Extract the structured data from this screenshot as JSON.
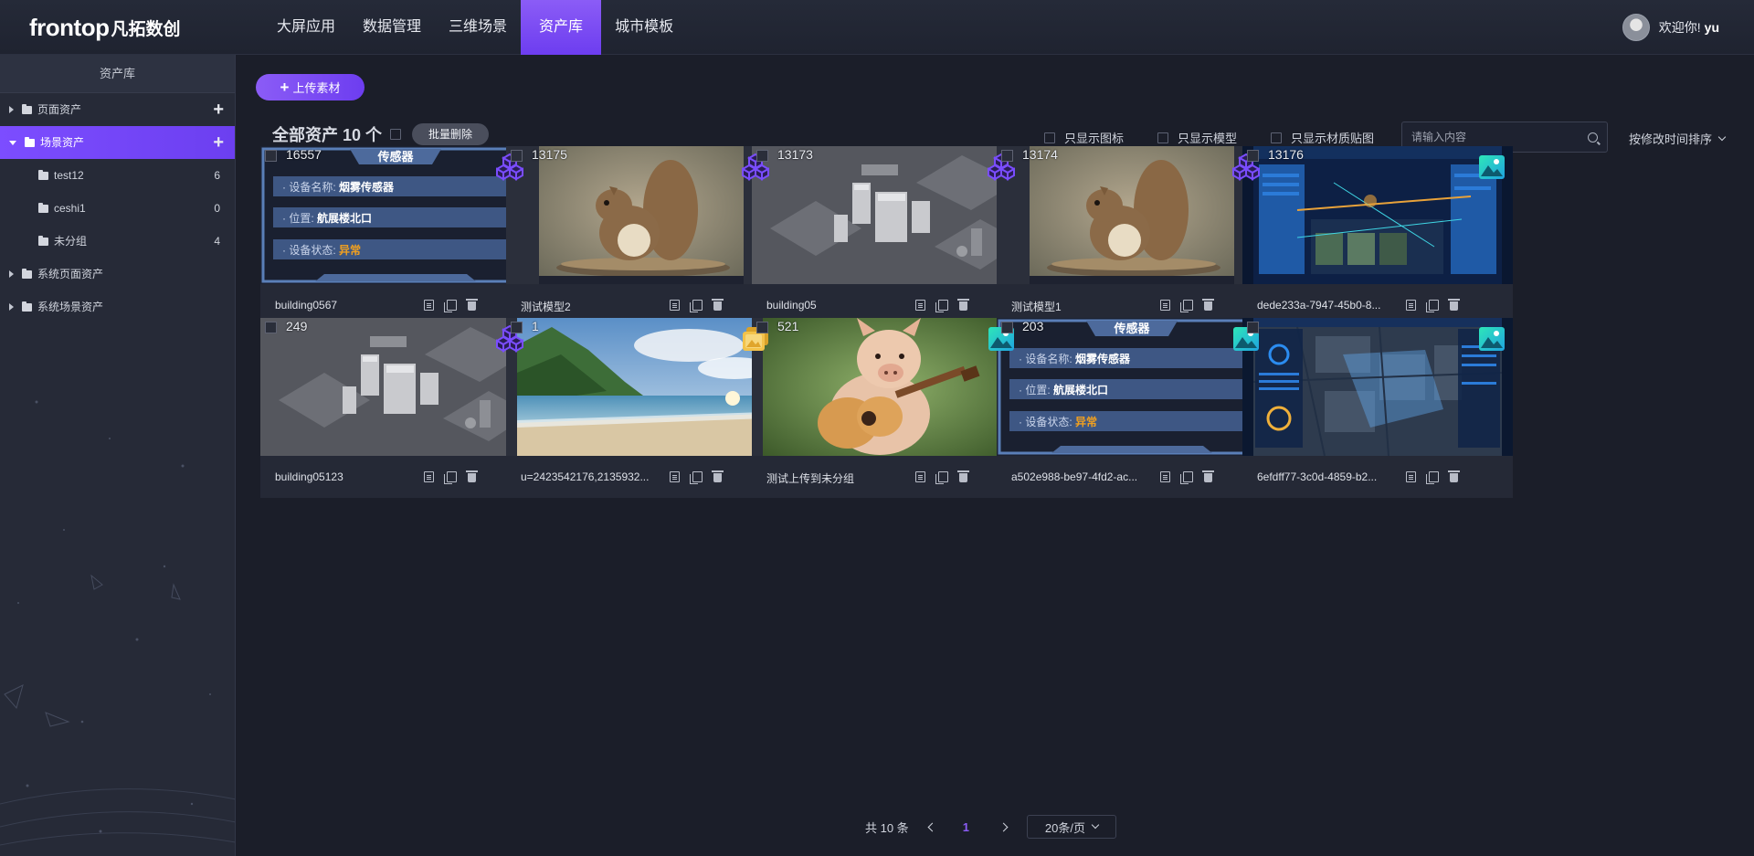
{
  "header": {
    "logo_text": "frontop",
    "logo_cn": "凡拓数创",
    "nav": [
      {
        "label": "大屏应用",
        "active": false
      },
      {
        "label": "数据管理",
        "active": false
      },
      {
        "label": "三维场景",
        "active": false
      },
      {
        "label": "资产库",
        "active": true
      },
      {
        "label": "城市模板",
        "active": false
      }
    ],
    "welcome": "欢迎你!",
    "username": "yu"
  },
  "sidebar": {
    "title": "资产库",
    "items": [
      {
        "label": "页面资产",
        "type": "group",
        "expanded": false,
        "addable": true
      },
      {
        "label": "场景资产",
        "type": "group",
        "expanded": true,
        "active": true,
        "addable": true
      },
      {
        "label": "test12",
        "type": "child",
        "count": "6"
      },
      {
        "label": "ceshi1",
        "type": "child",
        "count": "0"
      },
      {
        "label": "未分组",
        "type": "child",
        "count": "4"
      },
      {
        "label": "系统页面资产",
        "type": "group",
        "expanded": false
      },
      {
        "label": "系统场景资产",
        "type": "group",
        "expanded": false
      }
    ]
  },
  "toolbar": {
    "upload_label": "上传素材",
    "total_label": "全部资产 10 个",
    "batch_delete_label": "批量删除",
    "filters": [
      "只显示图标",
      "只显示模型",
      "只显示材质贴图"
    ],
    "search_placeholder": "请输入内容",
    "sort_label": "按修改时间排序"
  },
  "cards": [
    {
      "id": "16557",
      "name": "building0567",
      "thumb": "sensor",
      "badge": "model"
    },
    {
      "id": "13175",
      "name": "测试模型2",
      "thumb": "squirrel",
      "badge": "model"
    },
    {
      "id": "13173",
      "name": "building05",
      "thumb": "city",
      "badge": "model"
    },
    {
      "id": "13174",
      "name": "测试模型1",
      "thumb": "squirrel",
      "badge": "model"
    },
    {
      "id": "13176",
      "name": "dede233a-7947-45b0-8...",
      "thumb": "dashboard",
      "badge": "image"
    },
    {
      "id": "249",
      "name": "building05123",
      "thumb": "city",
      "badge": "model"
    },
    {
      "id": "1",
      "name": "u=2423542176,2135932...",
      "thumb": "beach",
      "badge": "texture"
    },
    {
      "id": "521",
      "name": "测试上传到未分组",
      "thumb": "pig",
      "badge": "image"
    },
    {
      "id": "203",
      "name": "a502e988-be97-4fd2-ac...",
      "thumb": "sensor",
      "badge": "image"
    },
    {
      "id": "",
      "name": "6efdff77-3c0d-4859-b2...",
      "thumb": "map",
      "badge": "image"
    }
  ],
  "sensor_panel": {
    "title": "传感器",
    "rows": [
      {
        "label": "设备名称:",
        "value": "烟雾传感器"
      },
      {
        "label": "位置:",
        "value": "航展楼北口"
      },
      {
        "label": "设备状态:",
        "value": "异常"
      }
    ]
  },
  "pagination": {
    "total_label": "共 10 条",
    "current_page": "1",
    "page_size_label": "20条/页"
  },
  "colors": {
    "accent": "#7c4dff",
    "bg": "#1b1e29",
    "warning": "#f0a020"
  }
}
